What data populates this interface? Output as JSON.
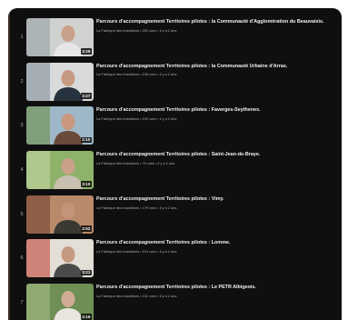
{
  "playlist": {
    "items": [
      {
        "index": "1",
        "title": "Parcours d'accompagnement Territoires pilotes : la Communauté d'Agglomération du Beauvaisis.",
        "channel": "La Fabrique des transitions",
        "views": "292 vues",
        "age": "il y a 2 ans",
        "duration": "3:29",
        "thumb": {
          "bg": "#cfd2cf",
          "accent": "#8f9aa0",
          "skin": "#c9a08a",
          "shirt": "#e6e6e6"
        }
      },
      {
        "index": "2",
        "title": "Parcours d'accompagnement Territoires pilotes : la Communauté Urbaine d'Arras.",
        "channel": "La Fabrique des transitions",
        "views": "108 vues",
        "age": "il y a 2 ans",
        "duration": "2:27",
        "thumb": {
          "bg": "#d9dadb",
          "accent": "#7b8a96",
          "skin": "#c79a82",
          "shirt": "#27323f"
        }
      },
      {
        "index": "3",
        "title": "Parcours d'accompagnement Territoires pilotes : Faverges-Seythenex.",
        "channel": "La Fabrique des transitions",
        "views": "109 vues",
        "age": "il y a 2 ans",
        "duration": "2:10",
        "thumb": {
          "bg": "#9eb8c8",
          "accent": "#6a8a3a",
          "skin": "#c9987d",
          "shirt": "#6a4a3a"
        }
      },
      {
        "index": "4",
        "title": "Parcours d'accompagnement Territoires pilotes : Saint-Jean-de-Braye.",
        "channel": "La Fabrique des transitions",
        "views": "70 vues",
        "age": "il y a 2 ans",
        "duration": "3:10",
        "thumb": {
          "bg": "#8fb26a",
          "accent": "#c9d9a8",
          "skin": "#caa089",
          "shirt": "#c8c0b0"
        }
      },
      {
        "index": "5",
        "title": "Parcours d'accompagnement Territoires pilotes : Vimy.",
        "channel": "La Fabrique des transitions",
        "views": "179 vues",
        "age": "il y a 2 ans",
        "duration": "2:52",
        "thumb": {
          "bg": "#b98a6a",
          "accent": "#6d3a2a",
          "skin": "#c49478",
          "shirt": "#3a3a32"
        }
      },
      {
        "index": "6",
        "title": "Parcours d'accompagnement Territoires pilotes : Lomme.",
        "channel": "La Fabrique des transitions",
        "views": "104 vues",
        "age": "il y a 2 ans",
        "duration": "3:21",
        "thumb": {
          "bg": "#e3ded6",
          "accent": "#c0392b",
          "skin": "#c69a80",
          "shirt": "#4a4a4a"
        }
      },
      {
        "index": "7",
        "title": "Parcours d'accompagnement Territoires pilotes : Le PETR Albigeois.",
        "channel": "La Fabrique des transitions",
        "views": "131 vues",
        "age": "il y a 2 ans",
        "duration": "3:16",
        "thumb": {
          "bg": "#6f8f55",
          "accent": "#a8c08a",
          "skin": "#d2ab95",
          "shirt": "#e9e5df"
        }
      }
    ]
  }
}
